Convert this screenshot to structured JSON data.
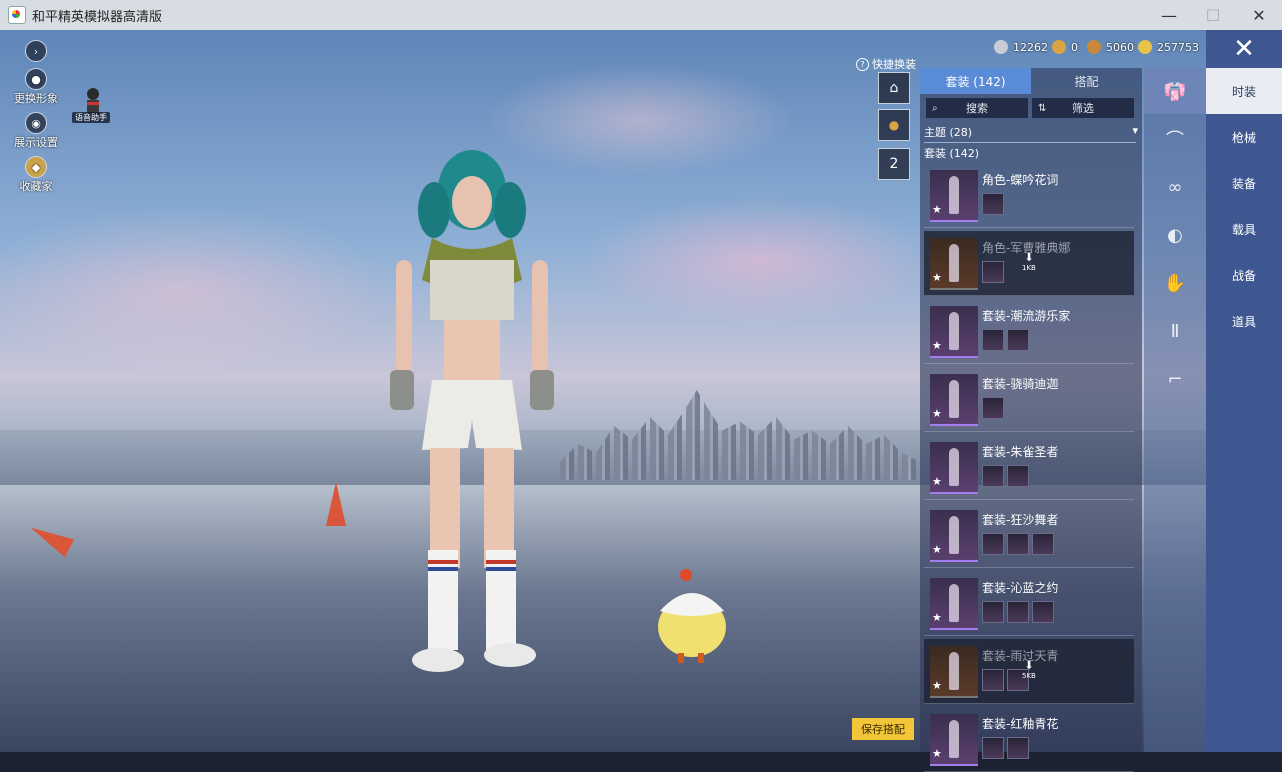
{
  "window": {
    "title": "和平精英模拟器高清版",
    "controls": [
      "—",
      "☐",
      "✕"
    ]
  },
  "left_menu": [
    {
      "icon": "arrow-right-icon",
      "label": ""
    },
    {
      "icon": "avatar-icon",
      "label": "更换形象"
    },
    {
      "icon": "eye-icon",
      "label": "展示设置"
    },
    {
      "icon": "collector-icon",
      "label": "收藏家"
    }
  ],
  "assistant_label": "语音助手",
  "currency": [
    {
      "icon": "silver-coin-icon",
      "value": "12262",
      "color": "#c9ccd6"
    },
    {
      "icon": "gold-badge-icon",
      "value": "0",
      "color": "#d9a441"
    },
    {
      "icon": "bronze-badge-icon",
      "value": "5060",
      "color": "#c88a3a"
    },
    {
      "icon": "gold-coin-icon",
      "value": "257753",
      "color": "#e8c34a"
    }
  ],
  "quick_change": {
    "icon_text": "?",
    "label": "快捷换装"
  },
  "hangers": [
    {
      "label": "♙"
    },
    {
      "label": "🔒"
    },
    {
      "label": "2"
    }
  ],
  "panel": {
    "tabs": [
      "套装 (142)",
      "搭配"
    ],
    "search_label": "搜索",
    "filter_label": "筛选",
    "theme_label": "主题 (28)",
    "suit_label": "套装 (142)",
    "items": [
      {
        "name": "角色-蝶吟花词",
        "downloaded": true,
        "subs": 1
      },
      {
        "name": "角色-军曹雅典娜",
        "downloaded": false,
        "size": "1KB",
        "subs": 1
      },
      {
        "name": "套装-潮流游乐家",
        "downloaded": true,
        "subs": 2
      },
      {
        "name": "套装-骁骑迪迦",
        "downloaded": true,
        "subs": 1
      },
      {
        "name": "套装-朱雀圣者",
        "downloaded": true,
        "subs": 2
      },
      {
        "name": "套装-狂沙舞者",
        "downloaded": true,
        "subs": 3
      },
      {
        "name": "套装-沁蓝之约",
        "downloaded": true,
        "subs": 3
      },
      {
        "name": "套装-雨过天青",
        "downloaded": false,
        "size": "5KB",
        "subs": 2
      },
      {
        "name": "套装-红釉青花",
        "downloaded": true,
        "subs": 2
      }
    ],
    "save_label": "保存搭配"
  },
  "category_icons": [
    "outfit-icon",
    "hat-icon",
    "glasses-icon",
    "mask-icon",
    "gloves-icon",
    "pants-icon",
    "shoes-icon"
  ],
  "sidebar": {
    "close_label": "✕",
    "items": [
      "时装",
      "枪械",
      "装备",
      "载具",
      "战备",
      "道具"
    ],
    "active": "时装"
  }
}
